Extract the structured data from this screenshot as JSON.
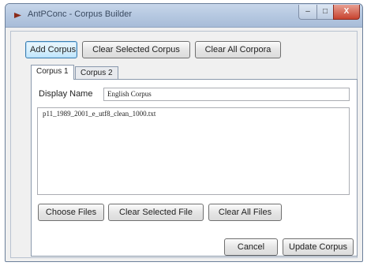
{
  "window": {
    "title": "AntPConc - Corpus Builder",
    "close_glyph": "X",
    "minimize_glyph": "–",
    "maximize_glyph": "□"
  },
  "toolbar": {
    "add_corpus": "Add Corpus",
    "clear_selected_corpus": "Clear Selected Corpus",
    "clear_all_corpora": "Clear All Corpora"
  },
  "tabs": [
    {
      "label": "Corpus 1"
    },
    {
      "label": "Corpus 2"
    }
  ],
  "corpus_panel": {
    "display_name_label": "Display Name",
    "display_name_value": "English Corpus",
    "files": [
      "p11_1989_2001_e_utf8_clean_1000.txt"
    ],
    "choose_files": "Choose Files",
    "clear_selected_file": "Clear Selected File",
    "clear_all_files": "Clear All Files"
  },
  "footer": {
    "cancel": "Cancel",
    "update_corpus": "Update Corpus"
  },
  "colors": {
    "titlebar": "#b4c7e0",
    "close_button": "#c7432f",
    "focus_border": "#3c7fb1"
  }
}
